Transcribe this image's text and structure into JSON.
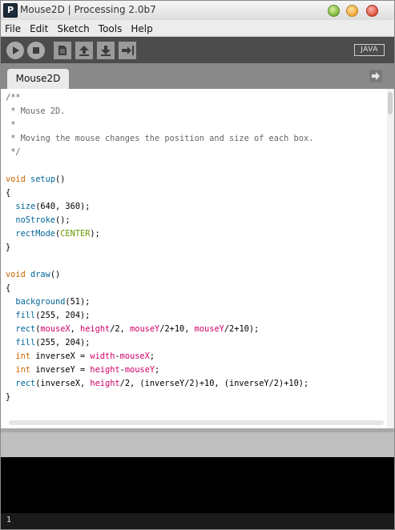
{
  "window": {
    "title": "Mouse2D | Processing 2.0b7",
    "app_icon_glyph": "P"
  },
  "menu": [
    "File",
    "Edit",
    "Sketch",
    "Tools",
    "Help"
  ],
  "toolbar": {
    "buttons": [
      "run-icon",
      "stop-icon",
      "new-icon",
      "open-icon",
      "save-icon",
      "export-icon"
    ],
    "mode": "JAVA"
  },
  "tabs": [
    {
      "label": "Mouse2D"
    }
  ],
  "editor": {
    "lines": [
      [
        {
          "t": "/**",
          "c": "comment"
        }
      ],
      [
        {
          "t": " * Mouse 2D.",
          "c": "comment"
        }
      ],
      [
        {
          "t": " *",
          "c": "comment"
        }
      ],
      [
        {
          "t": " * Moving the mouse changes the position and size of each box.",
          "c": "comment"
        }
      ],
      [
        {
          "t": " */",
          "c": "comment"
        }
      ],
      [],
      [
        {
          "t": "void",
          "c": "keyword"
        },
        {
          "t": " ",
          "c": "plain"
        },
        {
          "t": "setup",
          "c": "func"
        },
        {
          "t": "()",
          "c": "plain"
        }
      ],
      [
        {
          "t": "{",
          "c": "plain"
        }
      ],
      [
        {
          "t": "  ",
          "c": "plain"
        },
        {
          "t": "size",
          "c": "func"
        },
        {
          "t": "(640, 360);",
          "c": "plain"
        }
      ],
      [
        {
          "t": "  ",
          "c": "plain"
        },
        {
          "t": "noStroke",
          "c": "func"
        },
        {
          "t": "();",
          "c": "plain"
        }
      ],
      [
        {
          "t": "  ",
          "c": "plain"
        },
        {
          "t": "rectMode",
          "c": "func"
        },
        {
          "t": "(",
          "c": "plain"
        },
        {
          "t": "CENTER",
          "c": "const"
        },
        {
          "t": ");",
          "c": "plain"
        }
      ],
      [
        {
          "t": "}",
          "c": "plain"
        }
      ],
      [],
      [
        {
          "t": "void",
          "c": "keyword"
        },
        {
          "t": " ",
          "c": "plain"
        },
        {
          "t": "draw",
          "c": "func"
        },
        {
          "t": "()",
          "c": "plain"
        }
      ],
      [
        {
          "t": "{",
          "c": "plain"
        }
      ],
      [
        {
          "t": "  ",
          "c": "plain"
        },
        {
          "t": "background",
          "c": "func"
        },
        {
          "t": "(51);",
          "c": "plain"
        }
      ],
      [
        {
          "t": "  ",
          "c": "plain"
        },
        {
          "t": "fill",
          "c": "func"
        },
        {
          "t": "(255, 204);",
          "c": "plain"
        }
      ],
      [
        {
          "t": "  ",
          "c": "plain"
        },
        {
          "t": "rect",
          "c": "func"
        },
        {
          "t": "(",
          "c": "plain"
        },
        {
          "t": "mouseX",
          "c": "var"
        },
        {
          "t": ", ",
          "c": "plain"
        },
        {
          "t": "height",
          "c": "var"
        },
        {
          "t": "/2, ",
          "c": "plain"
        },
        {
          "t": "mouseY",
          "c": "var"
        },
        {
          "t": "/2+10, ",
          "c": "plain"
        },
        {
          "t": "mouseY",
          "c": "var"
        },
        {
          "t": "/2+10);",
          "c": "plain"
        }
      ],
      [
        {
          "t": "  ",
          "c": "plain"
        },
        {
          "t": "fill",
          "c": "func"
        },
        {
          "t": "(255, 204);",
          "c": "plain"
        }
      ],
      [
        {
          "t": "  ",
          "c": "plain"
        },
        {
          "t": "int",
          "c": "keyword"
        },
        {
          "t": " inverseX = ",
          "c": "plain"
        },
        {
          "t": "width",
          "c": "var"
        },
        {
          "t": "-",
          "c": "plain"
        },
        {
          "t": "mouseX",
          "c": "var"
        },
        {
          "t": ";",
          "c": "plain"
        }
      ],
      [
        {
          "t": "  ",
          "c": "plain"
        },
        {
          "t": "int",
          "c": "keyword"
        },
        {
          "t": " inverseY = ",
          "c": "plain"
        },
        {
          "t": "height",
          "c": "var"
        },
        {
          "t": "-",
          "c": "plain"
        },
        {
          "t": "mouseY",
          "c": "var"
        },
        {
          "t": ";",
          "c": "plain"
        }
      ],
      [
        {
          "t": "  ",
          "c": "plain"
        },
        {
          "t": "rect",
          "c": "func"
        },
        {
          "t": "(inverseX, ",
          "c": "plain"
        },
        {
          "t": "height",
          "c": "var"
        },
        {
          "t": "/2, (inverseY/2)+10, (inverseY/2)+10);",
          "c": "plain"
        }
      ],
      [
        {
          "t": "}",
          "c": "plain"
        }
      ]
    ]
  },
  "status": {
    "line_number": "1"
  },
  "colors": {
    "comment": "#666666",
    "keyword": "#cc6600",
    "function": "#006699",
    "variable": "#d10068",
    "constant": "#669900"
  }
}
